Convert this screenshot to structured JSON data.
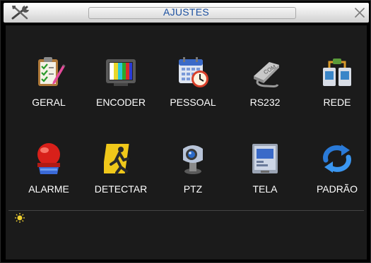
{
  "window": {
    "title": "AJUSTES"
  },
  "menu": {
    "items": [
      {
        "label": "GERAL",
        "icon": "clipboard-checklist-icon"
      },
      {
        "label": "ENCODER",
        "icon": "color-bars-monitor-icon"
      },
      {
        "label": "PESSOAL",
        "icon": "calendar-clock-icon"
      },
      {
        "label": "RS232",
        "icon": "com-port-icon"
      },
      {
        "label": "REDE",
        "icon": "network-computers-icon"
      },
      {
        "label": "ALARME",
        "icon": "alarm-beacon-icon"
      },
      {
        "label": "DETECTAR",
        "icon": "running-person-icon"
      },
      {
        "label": "PTZ",
        "icon": "ptz-camera-icon"
      },
      {
        "label": "TELA",
        "icon": "display-screen-icon"
      },
      {
        "label": "PADRÃO",
        "icon": "refresh-arrows-icon"
      }
    ]
  },
  "icons": {
    "rs232_port_text": "COM"
  },
  "colors": {
    "title_text": "#1a4fa0",
    "background": "#000000",
    "label_text": "#ffffff"
  }
}
